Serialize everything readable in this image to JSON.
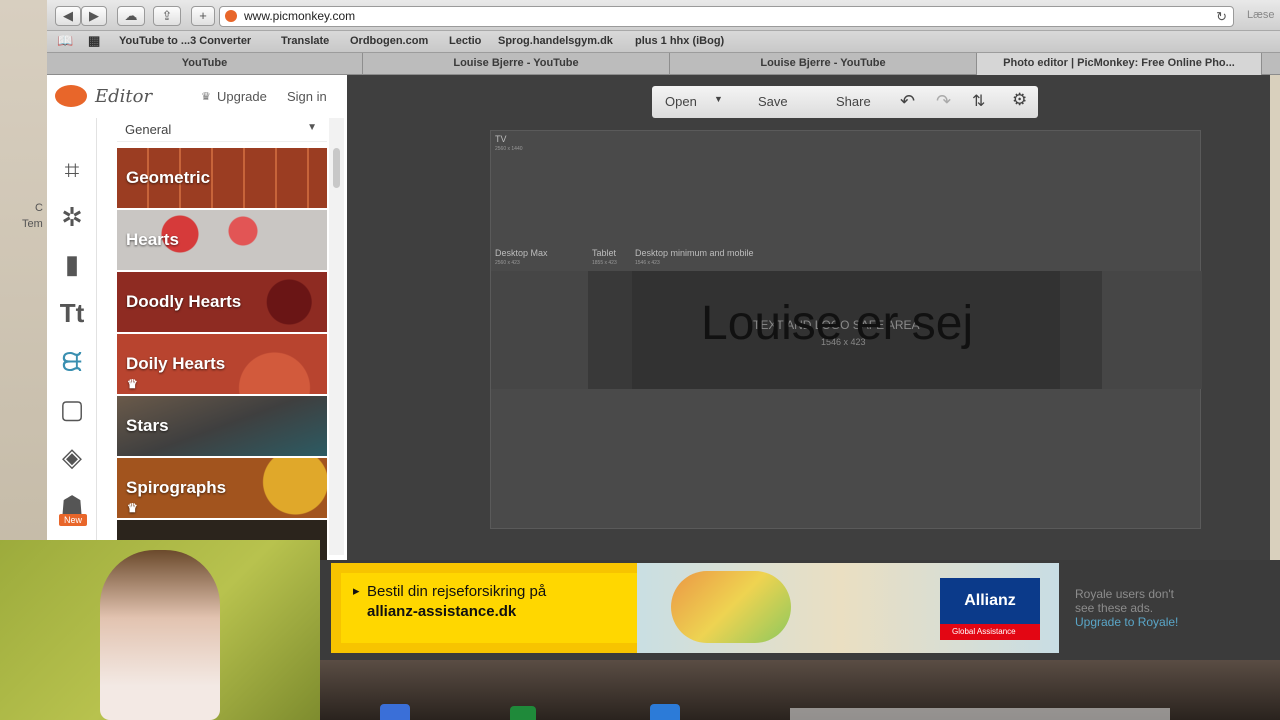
{
  "browser": {
    "url": "www.picmonkey.com",
    "bookmarks": [
      "YouTube to ...3 Converter",
      "Translate",
      "Ordbogen.com",
      "Lectio",
      "Sprog.handelsgym.dk",
      "plus 1 hhx (iBog)"
    ],
    "tabs": [
      "YouTube",
      "Louise Bjerre - YouTube",
      "Louise Bjerre - YouTube",
      "Photo editor | PicMonkey: Free Online Pho..."
    ],
    "right_edge_text": "Læse",
    "icons": {
      "back": "◀",
      "forward": "▶",
      "cloud": "☁",
      "share": "⇪",
      "new_tab": "+",
      "reload": "↻",
      "book": "📖",
      "grid": "▦"
    }
  },
  "editor": {
    "logo": "Editor",
    "upgrade": "Upgrade",
    "signin": "Sign in",
    "theme_select": "General",
    "new_badge": "New",
    "themes": [
      {
        "label": "Geometric",
        "color": "#a0462a"
      },
      {
        "label": "Hearts",
        "color": "#c9c6c3"
      },
      {
        "label": "Doodly Hearts",
        "color": "#8e2b22"
      },
      {
        "label": "Doily Hearts",
        "color": "#b8442f"
      },
      {
        "label": "Stars",
        "color": "#4a4a4a"
      },
      {
        "label": "Spirographs",
        "color": "#a2541e"
      }
    ]
  },
  "canvas_toolbar": {
    "open": "Open",
    "save": "Save",
    "share": "Share"
  },
  "canvas": {
    "tv_label": "TV",
    "tv_size": "2560 x 1440",
    "desktop_max": "Desktop Max",
    "desktop_max_size": "2560 x 423",
    "tablet": "Tablet",
    "tablet_size": "1855 x 423",
    "desktop_min": "Desktop minimum and mobile",
    "desktop_min_size": "1546 x 423",
    "safe_area": "TEXT AND LOGO SAFE AREA",
    "safe_size": "1546 x 423",
    "big_text": "Louise er sej"
  },
  "ad": {
    "line1": "Bestil din rejseforsikring på",
    "line2": "allianz-assistance.dk",
    "brand": "Allianz",
    "brand_sub": "Global Assistance"
  },
  "royale": {
    "line1": "Royale users don't",
    "line2": "see these ads.",
    "link": "Upgrade to Royale!"
  },
  "desktop": {
    "label1": "C",
    "label2": "Tem"
  }
}
